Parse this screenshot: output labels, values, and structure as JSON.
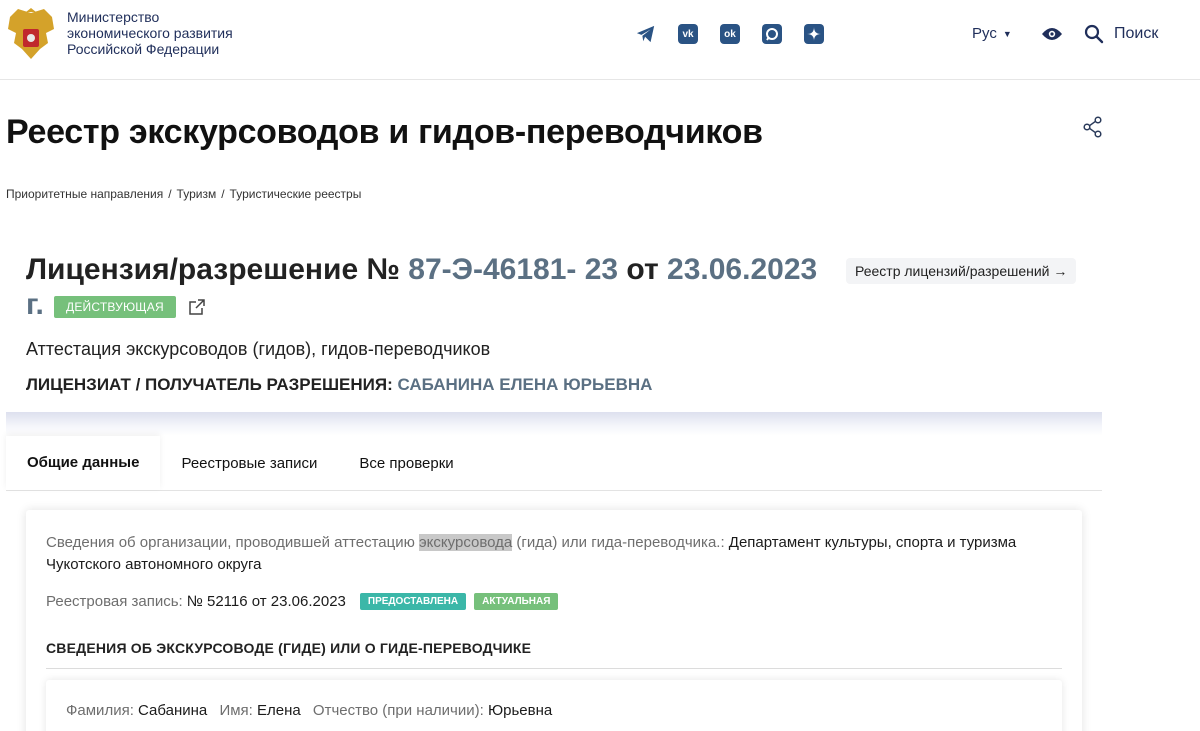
{
  "header": {
    "ministry_lines": [
      "Министерство",
      "экономического развития",
      "Российской Федерации"
    ],
    "socials": [
      {
        "icon": "telegram-icon"
      },
      {
        "icon": "vk-icon",
        "text": "vk"
      },
      {
        "icon": "odnoklassniki-icon",
        "text": "ok"
      },
      {
        "icon": "max-icon"
      },
      {
        "icon": "dzen-icon"
      }
    ],
    "lang": "Рус",
    "search_label": "Поиск"
  },
  "page": {
    "title": "Реестр экскурсоводов и гидов-переводчиков",
    "breadcrumb": [
      "Приоритетные направления",
      "Туризм",
      "Туристические реестры"
    ],
    "breadcrumb_sep": "/"
  },
  "license": {
    "prefix": "Лицензия/разрешение № ",
    "number": "87-Э-46181- 23",
    "from_word": " от ",
    "date": "23.06.2023",
    "g": "г.",
    "status": "ДЕЙСТВУЮЩАЯ",
    "registry_button": "Реестр лицензий/разрешений →",
    "subtitle": "Аттестация экскурсоводов (гидов), гидов-переводчиков",
    "licensee_label": "ЛИЦЕНЗИАТ / ПОЛУЧАТЕЛЬ РАЗРЕШЕНИЯ:",
    "licensee_name": "САБАНИНА ЕЛЕНА ЮРЬЕВНА"
  },
  "tabs": [
    {
      "label": "Общие данные",
      "active": true
    },
    {
      "label": "Реестровые записи",
      "active": false
    },
    {
      "label": "Все проверки",
      "active": false
    }
  ],
  "card": {
    "org_label_1": "Сведения об организации, проводившей аттестацию ",
    "org_label_mark": "экскурсовода",
    "org_label_2": " (гида) или гида-переводчика.:",
    "org_value": " Департамент культуры, спорта и туризма Чукотского автономного округа",
    "reg_label": "Реестровая запись:",
    "reg_value": "№ 52116 от 23.06.2023",
    "badge_1": "ПРЕДОСТАВЛЕНА",
    "badge_2": "АКТУАЛЬНАЯ",
    "section_title": "СВЕДЕНИЯ ОБ ЭКСКУРСОВОДЕ (ГИДЕ) ИЛИ О ГИДЕ-ПЕРЕВОДЧИКЕ",
    "surname_label": "Фамилия:",
    "surname": "Сабанина",
    "name_label": "Имя:",
    "name": "Елена",
    "patronymic_label": "Отчество (при наличии):",
    "patronymic": "Юрьевна"
  },
  "colors": {
    "accent": "#5b7083",
    "brand": "#1f2e5a",
    "status_green": "#76c07b",
    "status_teal": "#3bb7a8"
  }
}
